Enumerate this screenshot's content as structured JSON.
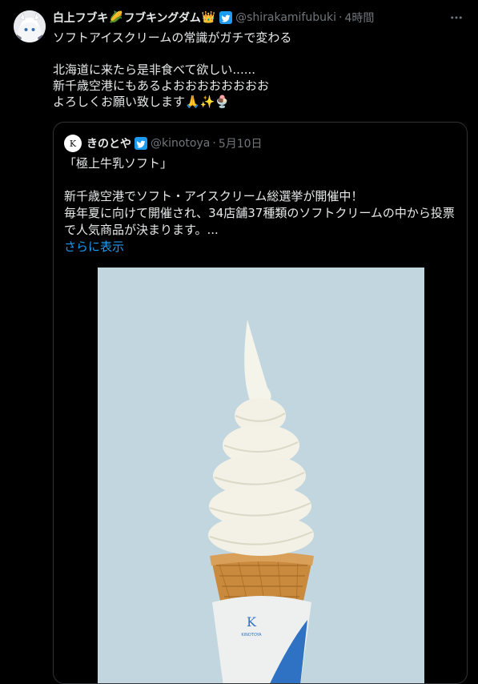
{
  "tweet": {
    "display_name": "白上フブキ",
    "name_suffix": "フブキングダム",
    "emoji_corn": "🌽",
    "emoji_crown": "👑",
    "handle": "@shirakamifubuki",
    "separator": "·",
    "time": "4時間",
    "more_icon": "…",
    "lines": [
      "ソフトアイスクリームの常識がガチで変わる",
      "",
      "北海道に来たら是非食べて欲しい......",
      "新千歳空港にもあるよおおおおおおおお",
      "よろしくお願い致します🙏✨🍨"
    ]
  },
  "quote": {
    "display_name": "きのとや",
    "handle": "@kinotoya",
    "separator": "·",
    "date": "5月10日",
    "lines": [
      "「極上牛乳ソフト」",
      "",
      "新千歳空港でソフト・アイスクリーム総選挙が開催中！",
      "毎年夏に向けて開催され、34店舗37種類のソフトクリームの中から投票",
      "で人気商品が決まります。..."
    ],
    "show_more": "さらに表示",
    "avatar_letter": "K",
    "cup_logo_letter": "K",
    "cup_logo_text": "KINOTOYA",
    "photo_bg": "#c1d6df"
  },
  "colors": {
    "background": "#000000",
    "text": "#e7e9ea",
    "muted": "#71767b",
    "accent": "#1d9bf0",
    "border": "#2f3336"
  },
  "icons": {
    "verified": "verified-badge-icon",
    "more": "more-options-icon"
  }
}
